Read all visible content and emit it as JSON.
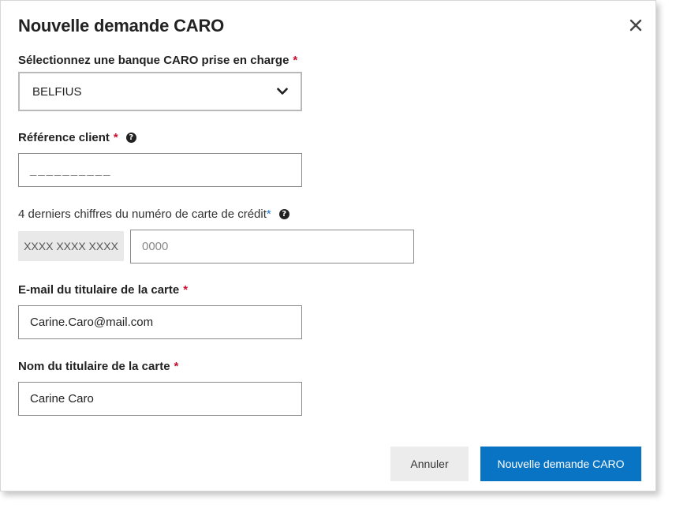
{
  "dialog": {
    "title": "Nouvelle demande CARO",
    "close_label": "Fermer"
  },
  "bank": {
    "label": "Sélectionnez une banque CARO prise en charge",
    "required_mark": "*",
    "selected_value": "BELFIUS"
  },
  "reference": {
    "label": "Référence client",
    "required_mark": "*",
    "placeholder": "__________"
  },
  "card_digits": {
    "label": "4 derniers chiffres du numéro de carte de crédit",
    "required_mark": "*",
    "prefix": "XXXX XXXX XXXX",
    "placeholder": "0000"
  },
  "email": {
    "label": "E-mail du titulaire de la carte",
    "required_mark": "*",
    "value": "Carine.Caro@mail.com"
  },
  "holder_name": {
    "label": "Nom du titulaire de la carte",
    "required_mark": "*",
    "value": "Carine Caro"
  },
  "buttons": {
    "cancel": "Annuler",
    "submit": "Nouvelle demande CARO"
  },
  "colors": {
    "primary": "#0a74c4",
    "required": "#c8102e",
    "required_alt": "#1a73c6"
  },
  "icons": {
    "close": "close-icon",
    "select_arrow": "chevron-down-icon",
    "help": "help-circle-icon"
  }
}
